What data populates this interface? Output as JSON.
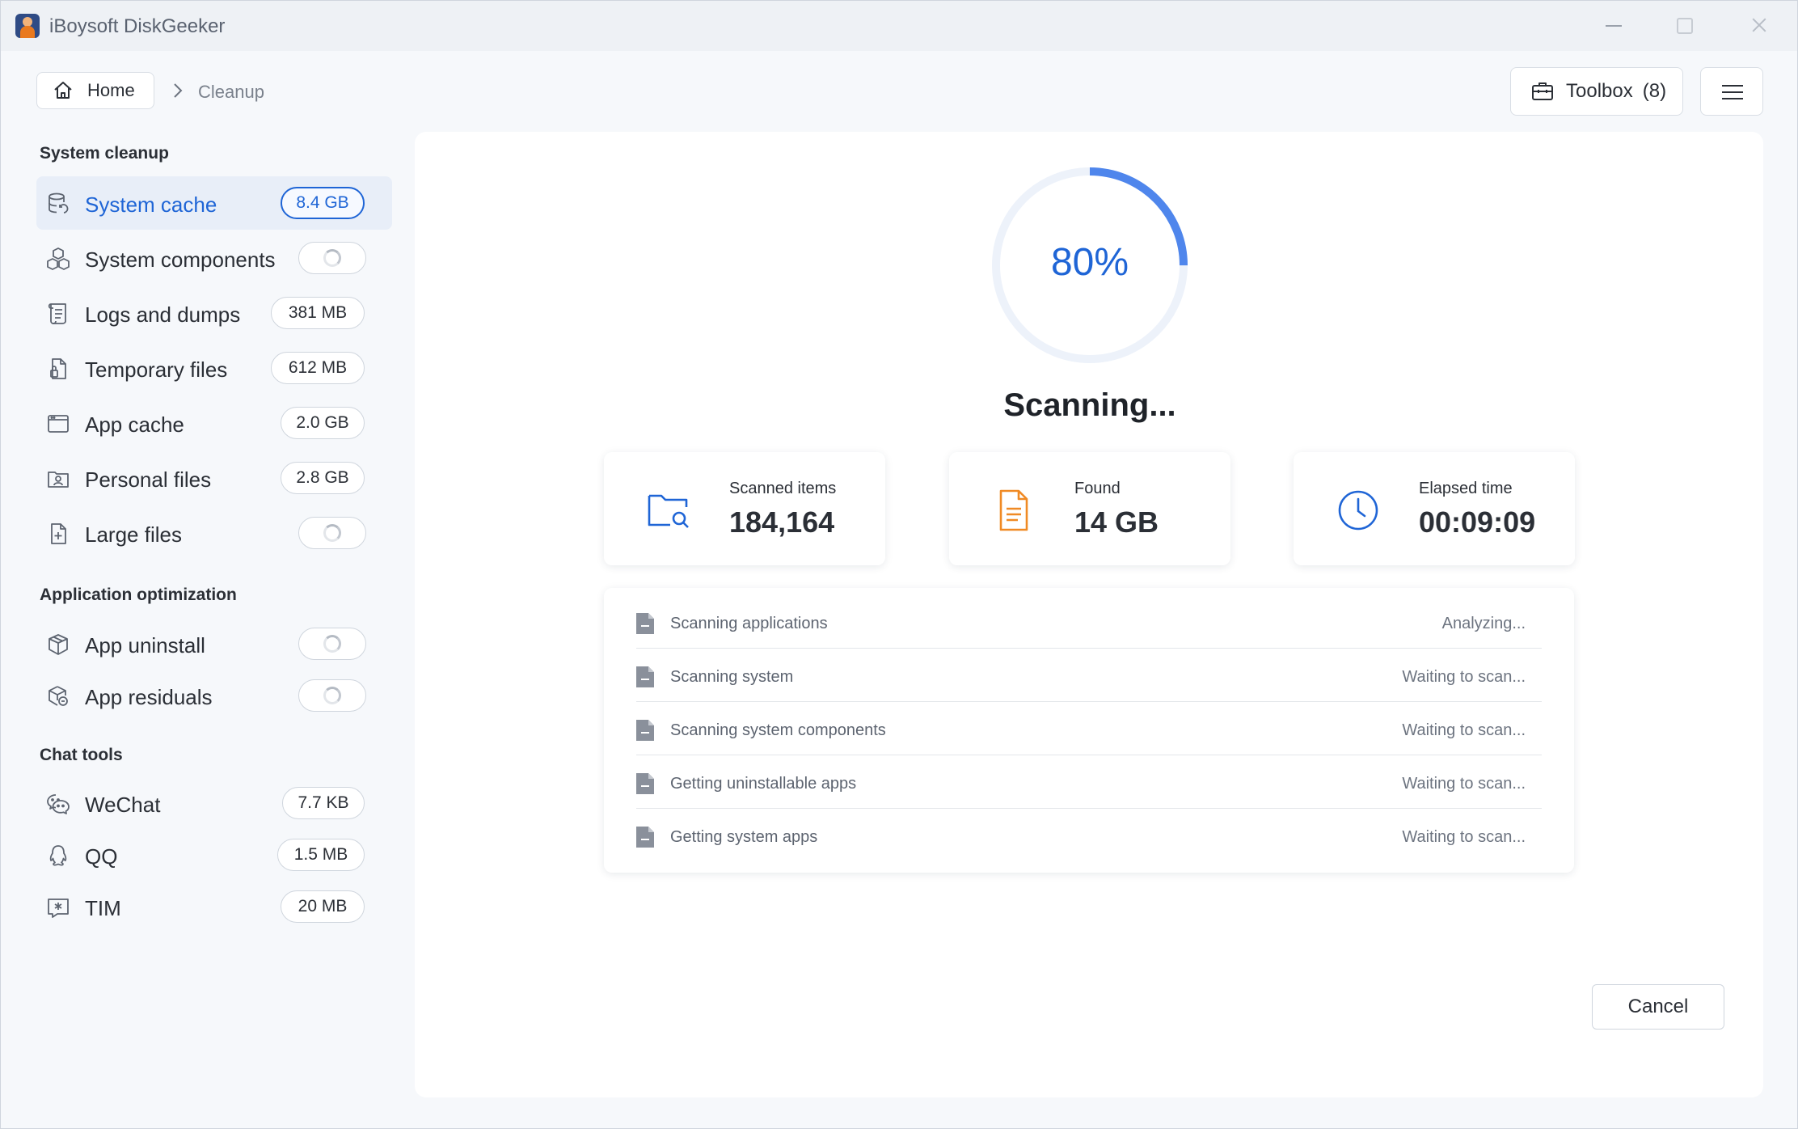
{
  "window": {
    "title": "iBoysoft DiskGeeker"
  },
  "breadcrumb": {
    "home_label": "Home",
    "current": "Cleanup"
  },
  "toolbar": {
    "toolbox_label": "Toolbox",
    "toolbox_count": "(8)"
  },
  "sidebar": {
    "sections": [
      {
        "title": "System cleanup",
        "items": [
          {
            "label": "System cache",
            "size": "8.4 GB",
            "active": true,
            "icon": "database-icon"
          },
          {
            "label": "System components",
            "size": null,
            "loading": true,
            "icon": "cubes-icon"
          },
          {
            "label": "Logs and dumps",
            "size": "381 MB",
            "icon": "scroll-icon"
          },
          {
            "label": "Temporary files",
            "size": "612 MB",
            "icon": "temp-file-icon"
          },
          {
            "label": "App cache",
            "size": "2.0 GB",
            "icon": "window-icon"
          },
          {
            "label": "Personal files",
            "size": "2.8 GB",
            "icon": "folder-user-icon"
          },
          {
            "label": "Large files",
            "size": null,
            "loading": true,
            "icon": "file-plus-icon"
          }
        ]
      },
      {
        "title": "Application optimization",
        "items": [
          {
            "label": "App uninstall",
            "size": null,
            "loading": true,
            "icon": "package-icon"
          },
          {
            "label": "App residuals",
            "size": null,
            "loading": true,
            "icon": "package-residual-icon"
          }
        ]
      },
      {
        "title": "Chat tools",
        "items": [
          {
            "label": "WeChat",
            "size": "7.7 KB",
            "icon": "wechat-icon"
          },
          {
            "label": "QQ",
            "size": "1.5 MB",
            "icon": "qq-icon"
          },
          {
            "label": "TIM",
            "size": "20 MB",
            "icon": "tim-icon"
          }
        ]
      }
    ]
  },
  "scan": {
    "progress_percent": 80,
    "progress_label": "80%",
    "title": "Scanning...",
    "stats": [
      {
        "caption": "Scanned items",
        "value": "184,164",
        "icon": "folder-search-icon",
        "color": "#1f65d6"
      },
      {
        "caption": "Found",
        "value": "14 GB",
        "icon": "document-icon",
        "color": "#f08a24"
      },
      {
        "caption": "Elapsed time",
        "value": "00:09:09",
        "icon": "clock-icon",
        "color": "#1f65d6"
      }
    ],
    "tasks": [
      {
        "name": "Scanning applications",
        "status": "Analyzing..."
      },
      {
        "name": "Scanning system",
        "status": "Waiting to scan..."
      },
      {
        "name": "Scanning system components",
        "status": "Waiting to scan..."
      },
      {
        "name": "Getting uninstallable apps",
        "status": "Waiting to scan..."
      },
      {
        "name": "Getting system apps",
        "status": "Waiting to scan..."
      }
    ],
    "cancel_label": "Cancel"
  },
  "colors": {
    "accent": "#1f65d6",
    "ring_track": "#edf2fa",
    "ring_fill": "#4f86ec",
    "found": "#f08a24"
  }
}
